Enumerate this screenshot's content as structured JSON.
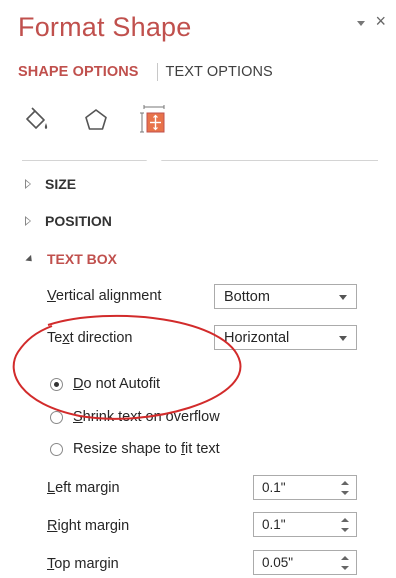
{
  "pane": {
    "title": "Format Shape",
    "controls": {
      "dropdown_icon": "chevron-down-icon",
      "close_glyph": "×"
    }
  },
  "tabs": [
    {
      "label": "SHAPE OPTIONS",
      "active": true
    },
    {
      "label": "TEXT OPTIONS",
      "active": false
    }
  ],
  "icon_tabs": [
    {
      "icon": "fill-line-icon",
      "active": false
    },
    {
      "icon": "effects-pentagon-icon",
      "active": false
    },
    {
      "icon": "size-properties-icon",
      "active": true
    }
  ],
  "sections": [
    {
      "label": "SIZE",
      "expanded": false
    },
    {
      "label": "POSITION",
      "expanded": false
    },
    {
      "label": "TEXT BOX",
      "expanded": true
    }
  ],
  "textbox": {
    "vertical_alignment": {
      "label_pre": "",
      "label_u": "V",
      "label_post": "ertical alignment",
      "value": "Bottom"
    },
    "text_direction": {
      "label_pre": "Te",
      "label_u": "x",
      "label_post": "t direction",
      "value": "Horizontal"
    },
    "autofit": [
      {
        "pre": "",
        "u": "D",
        "post": "o not Autofit",
        "checked": true
      },
      {
        "pre": "",
        "u": "S",
        "post": "hrink text on overflow",
        "checked": false
      },
      {
        "pre": "Resize shape to ",
        "u": "f",
        "post": "it text",
        "checked": false
      }
    ],
    "margins": [
      {
        "pre": "",
        "u": "L",
        "post": "eft margin",
        "value": "0.1\""
      },
      {
        "pre": "",
        "u": "R",
        "post": "ight margin",
        "value": "0.1\""
      },
      {
        "pre": "",
        "u": "T",
        "post": "op margin",
        "value": "0.05\""
      }
    ]
  },
  "colors": {
    "accent": "#c0504d",
    "annotation": "#d22b2b"
  }
}
